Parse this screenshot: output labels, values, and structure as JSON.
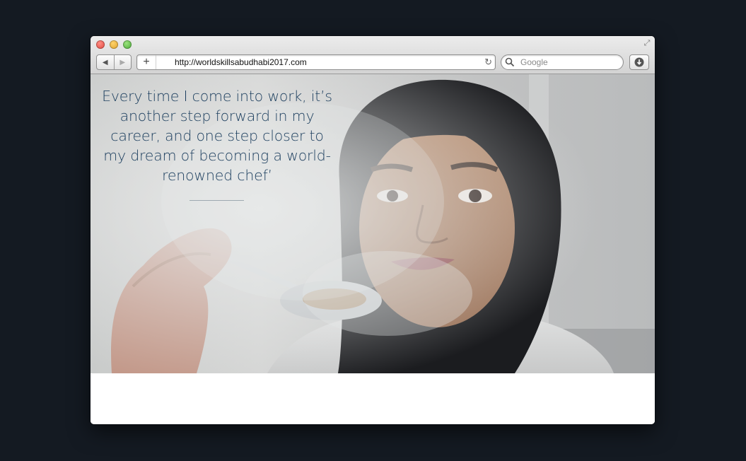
{
  "browser": {
    "url": "http://worldskillsabudhabi2017.com",
    "search_placeholder": "Google",
    "new_tab_glyph": "+",
    "reload_glyph": "↻",
    "back_glyph": "◀",
    "forward_glyph": "▶",
    "fullscreen_glyph": "⤢"
  },
  "hero": {
    "quote": "Every time I come into work, it’s another step forward in my career, and one step closer to my dream of becoming a world-renowned chef’",
    "image": "chef-tasting-from-spoon-photo"
  },
  "colors": {
    "page_background": "#141a22",
    "quote_text": "#1d3f5f"
  }
}
